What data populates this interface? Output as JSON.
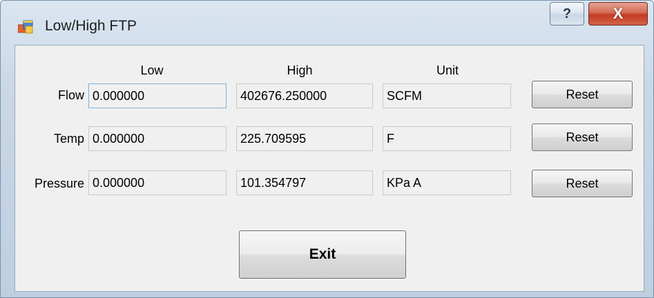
{
  "window": {
    "title": "Low/High FTP",
    "help_label": "?",
    "close_label": "X"
  },
  "headers": {
    "low": "Low",
    "high": "High",
    "unit": "Unit"
  },
  "rows": [
    {
      "label": "Flow",
      "low": "0.000000",
      "high": "402676.250000",
      "unit": "SCFM",
      "reset": "Reset"
    },
    {
      "label": "Temp",
      "low": "0.000000",
      "high": "225.709595",
      "unit": "F",
      "reset": "Reset"
    },
    {
      "label": "Pressure",
      "low": "0.000000",
      "high": "101.354797",
      "unit": "KPa A",
      "reset": "Reset"
    }
  ],
  "exit_label": "Exit",
  "icons": {
    "app": "form-window-icon",
    "help": "question-mark-icon",
    "close": "close-x-icon"
  },
  "colors": {
    "close_button": "#c23b22",
    "client_bg": "#f0f0f0",
    "focus_border": "#7fb1d8"
  }
}
